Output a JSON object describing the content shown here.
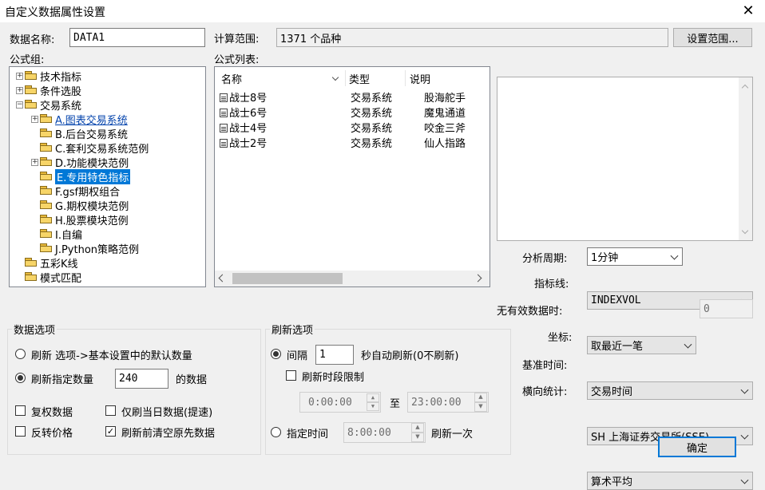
{
  "window": {
    "title": "自定义数据属性设置"
  },
  "data_name": {
    "label": "数据名称:",
    "value": "DATA1"
  },
  "calc_range": {
    "label": "计算范围:",
    "value": "1371 个品种",
    "button": "设置范围..."
  },
  "formula_group": {
    "label": "公式组:",
    "items": [
      "技术指标",
      "条件选股",
      "交易系统",
      "A.图表交易系统",
      "B.后台交易系统",
      "C.套利交易系统范例",
      "D.功能模块范例",
      "E.专用特色指标",
      "F.gsf期权组合",
      "G.期权模块范例",
      "H.股票模块范例",
      "I.自编",
      "J.Python策略范例",
      "五彩K线",
      "模式匹配"
    ]
  },
  "formula_list": {
    "label": "公式列表:",
    "headers": [
      "名称",
      "类型",
      "说明"
    ],
    "rows": [
      {
        "name": "战士8号",
        "type": "交易系统",
        "desc": "股海舵手"
      },
      {
        "name": "战士6号",
        "type": "交易系统",
        "desc": "魔鬼通道"
      },
      {
        "name": "战士4号",
        "type": "交易系统",
        "desc": "咬金三斧"
      },
      {
        "name": "战士2号",
        "type": "交易系统",
        "desc": "仙人指路"
      }
    ]
  },
  "right_form": {
    "period": {
      "label": "分析周期:",
      "value": "1分钟"
    },
    "indicator_line": {
      "label": "指标线:",
      "value": "INDEXVOL"
    },
    "no_valid_data": {
      "label": "无有效数据时:",
      "value": "取最近一笔",
      "extra": "0"
    },
    "coordinate": {
      "label": "坐标:",
      "value": "交易时间"
    },
    "base_time": {
      "label": "基准时间:",
      "value": "SH 上海证券交易所(SSE)"
    },
    "horizontal_stat": {
      "label": "横向统计:",
      "value": "算术平均"
    }
  },
  "data_options": {
    "title": "数据选项",
    "refresh_default": "刷新 选项->基本设置中的默认数量",
    "refresh_count": "刷新指定数量",
    "count_value": "240",
    "count_suffix": "的数据",
    "restore_rights": "复权数据",
    "today_only": "仅刷当日数据(提速)",
    "reverse_price": "反转价格",
    "clear_before": "刷新前清空原先数据"
  },
  "refresh_options": {
    "title": "刷新选项",
    "interval_label": "间隔",
    "interval_value": "1",
    "interval_suffix": "秒自动刷新(0不刷新)",
    "time_limit": "刷新时段限制",
    "from_time": "0:00:00",
    "to_label": "至",
    "to_time": "23:00:00",
    "at_time_label": "指定时间",
    "at_time_value": "8:00:00",
    "at_time_suffix": "刷新一次"
  },
  "ok_button": "确定",
  "colors": {
    "accent": "#0078d7",
    "selection": "#0078d7",
    "link": "#0645ad"
  }
}
